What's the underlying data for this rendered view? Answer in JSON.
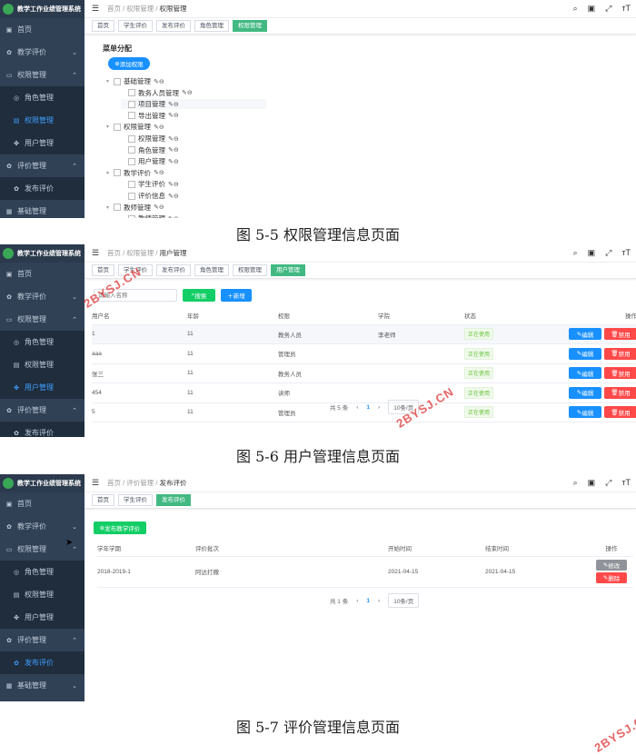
{
  "app_title": "教学工作业绩管理系统",
  "sidebar": {
    "home": "首页",
    "teaching_eval": "教学评价",
    "perm_mgmt": "权限管理",
    "role_mgmt": "角色管理",
    "perm_item": "权限管理",
    "user_mgmt": "用户管理",
    "eval_mgmt": "评价管理",
    "publish_eval": "发布评价",
    "basic_mgmt": "基础管理"
  },
  "tags": {
    "home": "首页",
    "student_eval": "学生评价",
    "publish_eval": "发布评价",
    "role_mgmt": "角色管理",
    "perm_mgmt": "权限管理",
    "user_mgmt": "用户管理"
  },
  "shot1": {
    "breadcrumb": [
      "首页",
      "权限管理",
      "权限管理"
    ],
    "section_title": "菜单分配",
    "add_button": "添加权限",
    "tree": [
      {
        "label": "基础管理",
        "level": 0
      },
      {
        "label": "教务人员管理",
        "level": 1
      },
      {
        "label": "项目管理",
        "level": 1
      },
      {
        "label": "导出管理",
        "level": 1
      },
      {
        "label": "权限管理",
        "level": 0
      },
      {
        "label": "权限管理",
        "level": 1
      },
      {
        "label": "角色管理",
        "level": 1
      },
      {
        "label": "用户管理",
        "level": 1
      },
      {
        "label": "教学评价",
        "level": 0
      },
      {
        "label": "学生评价",
        "level": 1
      },
      {
        "label": "评价信息",
        "level": 1
      },
      {
        "label": "教师管理",
        "level": 0
      },
      {
        "label": "教师管理",
        "level": 1
      }
    ],
    "caption": "图 5-5 权限管理信息页面"
  },
  "shot2": {
    "breadcrumb": [
      "首页",
      "权限管理",
      "用户管理"
    ],
    "search_placeholder": "请输入名称",
    "search_button": "搜索",
    "add_button": "新增",
    "columns": [
      "用户名",
      "年龄",
      "权限",
      "学院",
      "状态",
      "操作"
    ],
    "rows": [
      {
        "name": "1",
        "age": "11",
        "role": "教务人员",
        "college": "李老师",
        "status": "正在使用"
      },
      {
        "name": "aaa",
        "age": "11",
        "role": "管理员",
        "college": "",
        "status": "正在使用"
      },
      {
        "name": "张三",
        "age": "11",
        "role": "教务人员",
        "college": "",
        "status": "正在使用"
      },
      {
        "name": "454",
        "age": "11",
        "role": "讲师",
        "college": "",
        "status": "正在使用"
      },
      {
        "name": "5",
        "age": "11",
        "role": "管理员",
        "college": "",
        "status": "正在使用"
      }
    ],
    "edit_label": "编辑",
    "disable_label": "禁用",
    "pager_total": "共 5 条",
    "pager_page": "1",
    "pager_size": "10条/页",
    "caption": "图 5-6 用户管理信息页面"
  },
  "shot3": {
    "breadcrumb": [
      "首页",
      "评价管理",
      "发布评价"
    ],
    "publish_button": "发布教学评价",
    "columns": [
      "学年学期",
      "评价批次",
      "开始时间",
      "结束时间",
      "操作"
    ],
    "rows": [
      {
        "term": "2018-2019-1",
        "batch": "阿达打撒",
        "start": "2021-04-15",
        "end": "2021-04-15"
      }
    ],
    "modify_label": "修改",
    "delete_label": "删除",
    "pager_total": "共 1 条",
    "pager_page": "1",
    "pager_size": "10条/页",
    "caption": "图 5-7 评价管理信息页面"
  },
  "watermark": "2BYSJ.CN",
  "colors": {
    "sidebar_bg": "#304156",
    "active_blue": "#409eff",
    "tag_active": "#42b983",
    "primary": "#1890ff",
    "success": "#13ce66",
    "danger": "#ff4949"
  }
}
